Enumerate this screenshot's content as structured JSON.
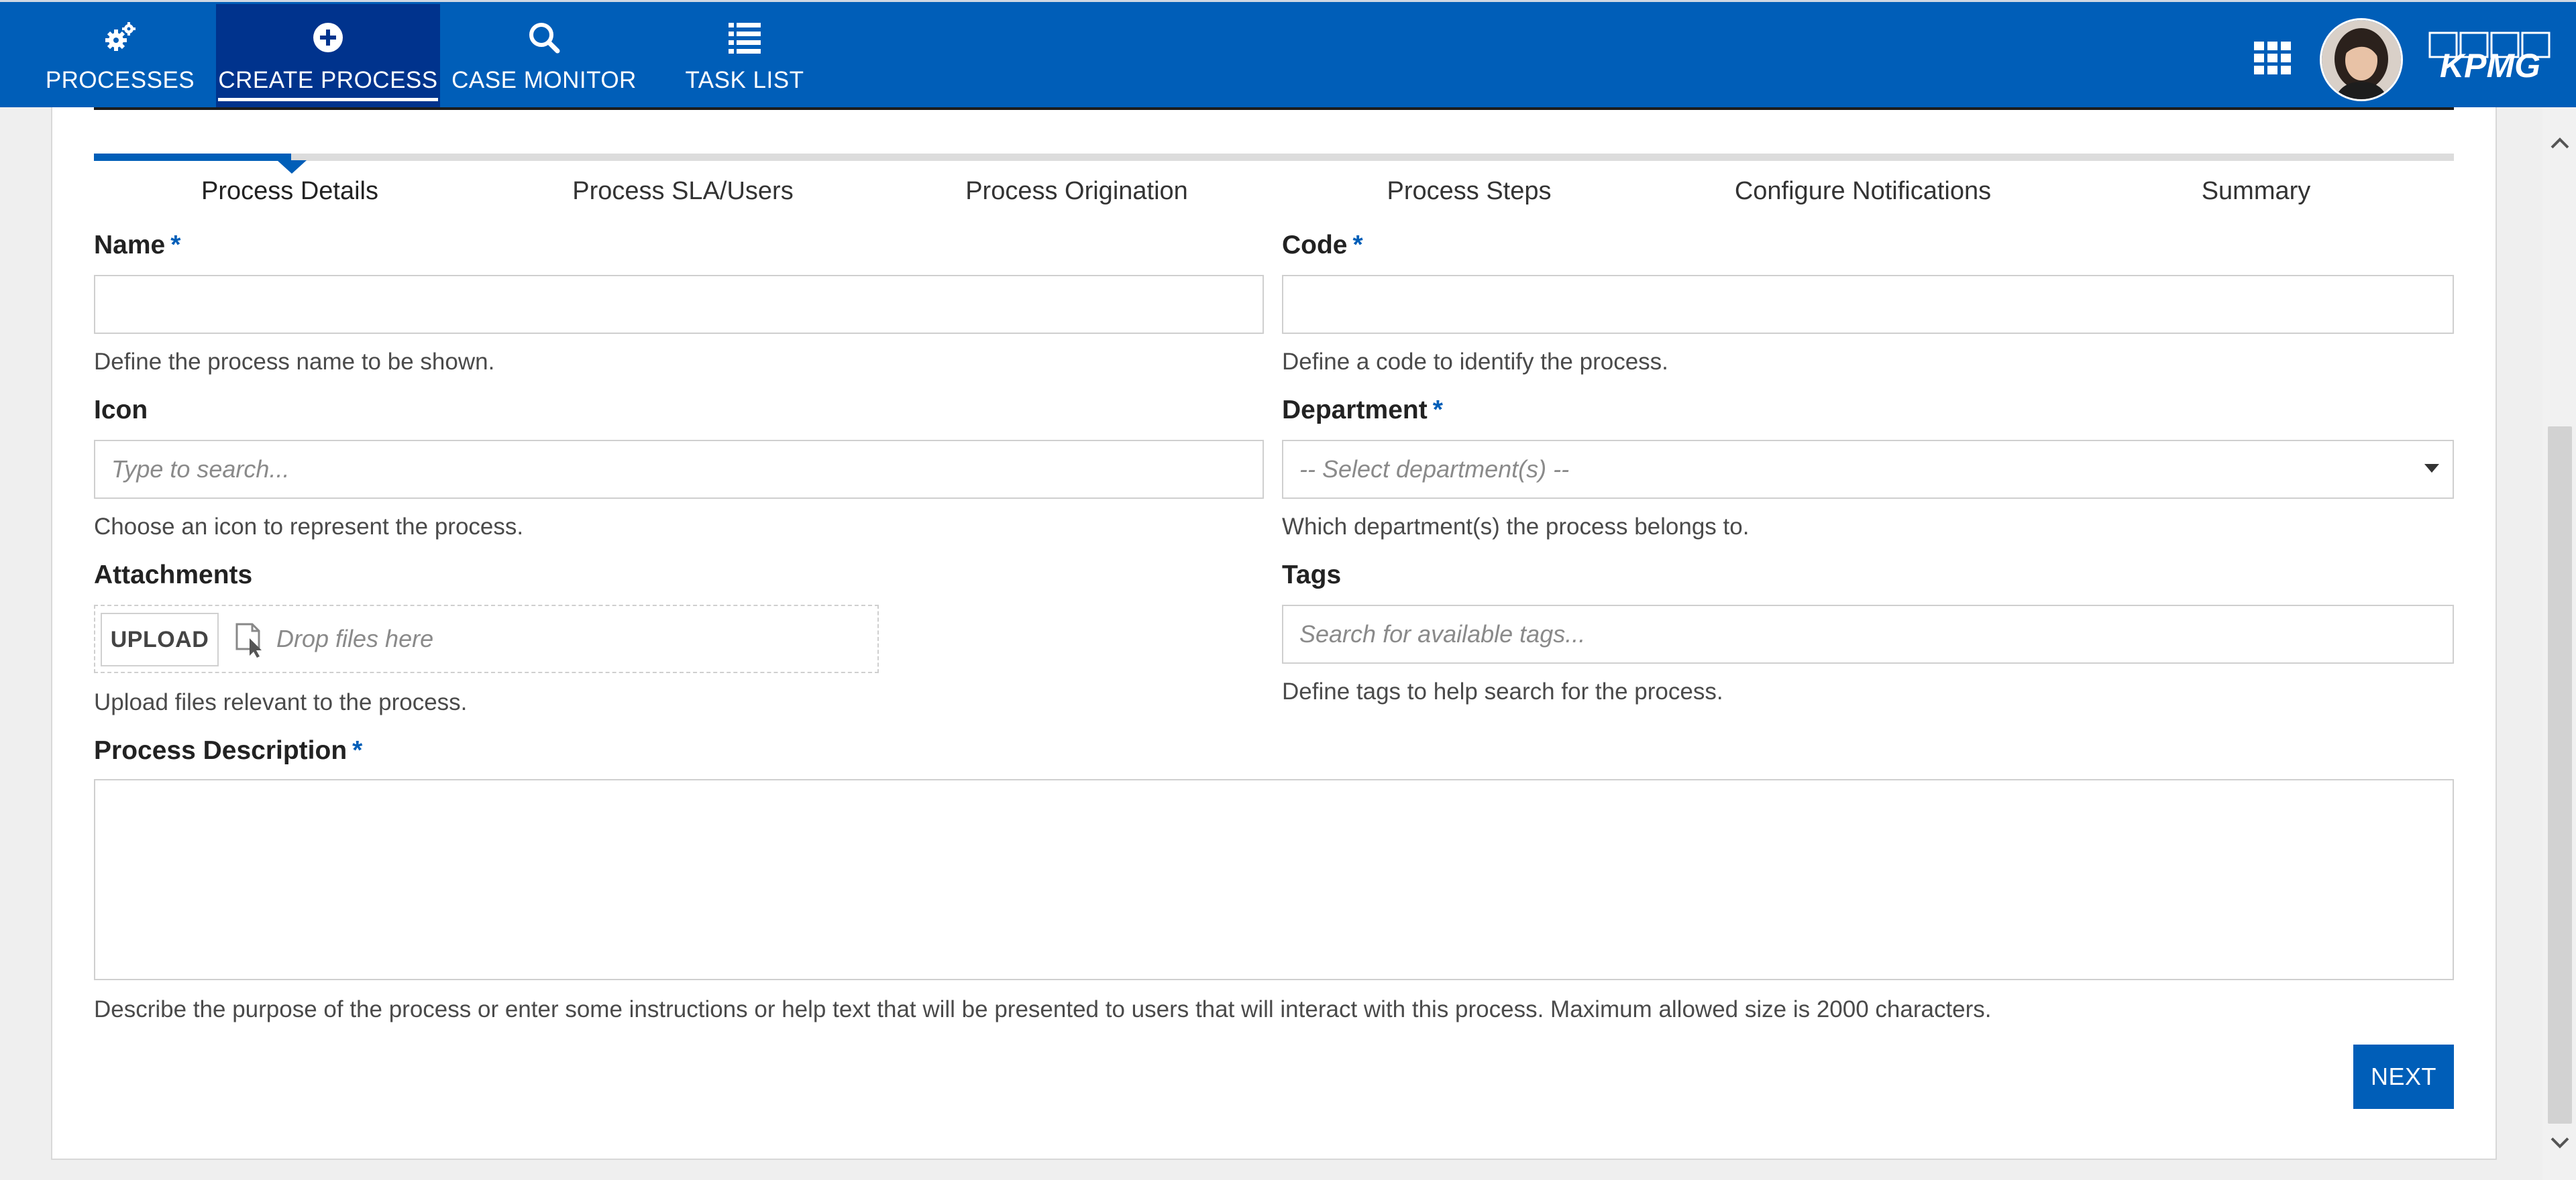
{
  "nav": {
    "items": [
      {
        "label": "PROCESSES",
        "icon": "gears-icon"
      },
      {
        "label": "CREATE PROCESS",
        "icon": "plus-circle-icon"
      },
      {
        "label": "CASE MONITOR",
        "icon": "search-icon"
      },
      {
        "label": "TASK LIST",
        "icon": "list-icon"
      }
    ],
    "active_index": 1,
    "apps_icon": "apps-grid-icon",
    "brand_logo": "KPMG"
  },
  "steps": [
    {
      "label": "Process Details"
    },
    {
      "label": "Process SLA/Users"
    },
    {
      "label": "Process Origination"
    },
    {
      "label": "Process Steps"
    },
    {
      "label": "Configure Notifications"
    },
    {
      "label": "Summary"
    }
  ],
  "active_step": 0,
  "form": {
    "required_mark": "*",
    "name": {
      "label": "Name",
      "value": "",
      "help": "Define the process name to be shown."
    },
    "code": {
      "label": "Code",
      "value": "",
      "help": "Define a code to identify the process."
    },
    "icon": {
      "label": "Icon",
      "placeholder": "Type to search...",
      "help": "Choose an icon to represent the process."
    },
    "department": {
      "label": "Department",
      "placeholder": "-- Select department(s) --",
      "help": "Which department(s) the process belongs to."
    },
    "attachments": {
      "label": "Attachments",
      "upload_label": "UPLOAD",
      "drop_text": "Drop files here",
      "help": "Upload files relevant to the process."
    },
    "tags": {
      "label": "Tags",
      "placeholder": "Search for available tags...",
      "help": "Define tags to help search for the process."
    },
    "description": {
      "label": "Process Description",
      "value": "",
      "help": "Describe the purpose of the process or enter some instructions or help text that will be presented to users that will interact with this process. Maximum allowed size is 2000 characters."
    }
  },
  "actions": {
    "next_label": "NEXT"
  },
  "colors": {
    "primary": "#005eb8",
    "nav_active": "#00338d",
    "card_bg": "#ffffff",
    "page_bg": "#efefef"
  }
}
